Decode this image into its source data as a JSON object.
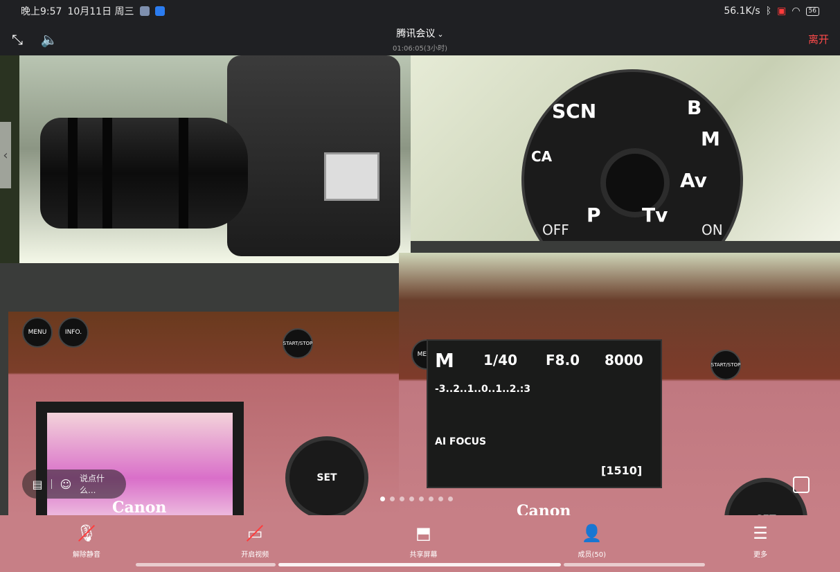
{
  "status_bar": {
    "time": "晚上9:57",
    "date": "10月11日 周三",
    "network_speed": "56.1K/s",
    "battery": "56"
  },
  "header": {
    "title": "腾讯会议",
    "duration": "01:06:05(3小时)",
    "leave_label": "离开"
  },
  "video": {
    "dial_labels": [
      "SCN",
      "CA",
      "B",
      "M",
      "Av",
      "Tv",
      "P",
      "OFF",
      "ON"
    ],
    "lcd_mode": "M",
    "lcd_shutter": "1/40",
    "lcd_aperture": "F8.0",
    "lcd_iso": "8000",
    "lcd_scale": "-3..2..1..0..1..2.:3",
    "lcd_focus": "AI FOCUS",
    "lcd_shots": "[1510]",
    "brand": "Canon",
    "set_label": "SET",
    "menu_label": "MENU",
    "info_label": "INFO.",
    "start_stop_label": "START/STOP"
  },
  "chat": {
    "placeholder": "说点什么..."
  },
  "page_indicator": {
    "count": 8,
    "active": 0
  },
  "toolbar": {
    "unmute": "解除静音",
    "start_video": "开启视频",
    "share_screen": "共享屏幕",
    "members": "成员(50)",
    "more": "更多"
  }
}
